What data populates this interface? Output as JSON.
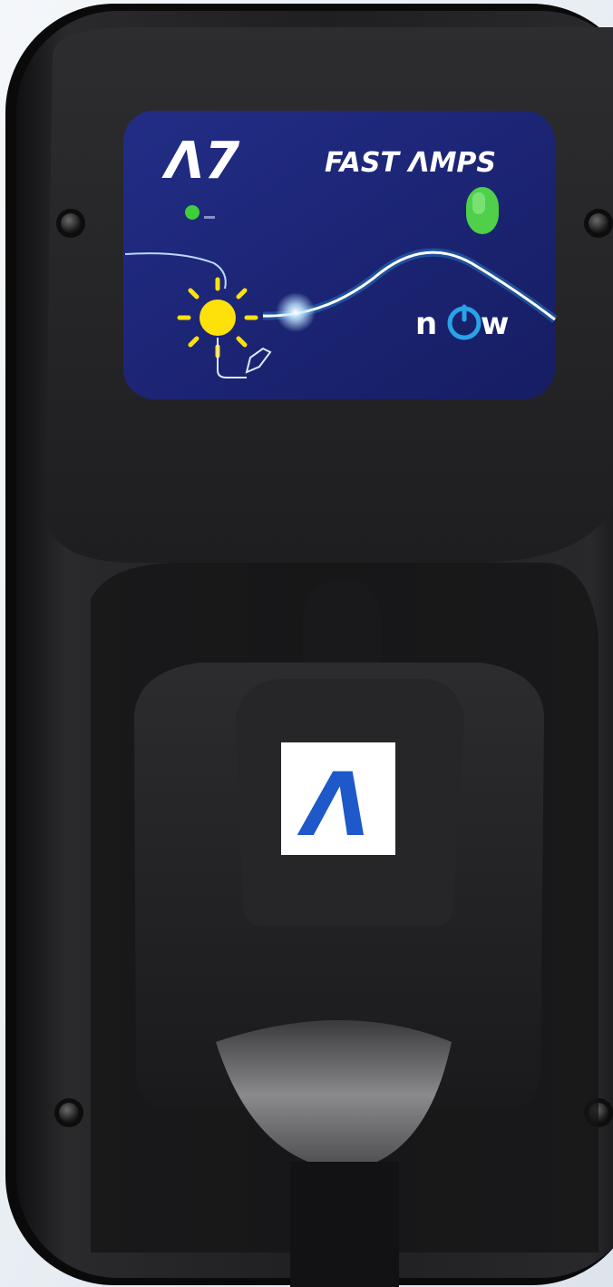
{
  "product": {
    "logo_text": "Λ7",
    "brand_text": "FAST ΛMPS",
    "now_logo": {
      "prefix": "n",
      "suffix": "w",
      "icon": "power-icon"
    },
    "holster_logo": "Λ",
    "led_status": "green"
  },
  "colors": {
    "background": "#e9eef3",
    "housing": "#1d1d1f",
    "panel": "#1c2577",
    "led": "#3ecf3a",
    "sun": "#ffe10a",
    "accent_blue": "#29a3e8",
    "logo_blue": "#1f58c8"
  }
}
